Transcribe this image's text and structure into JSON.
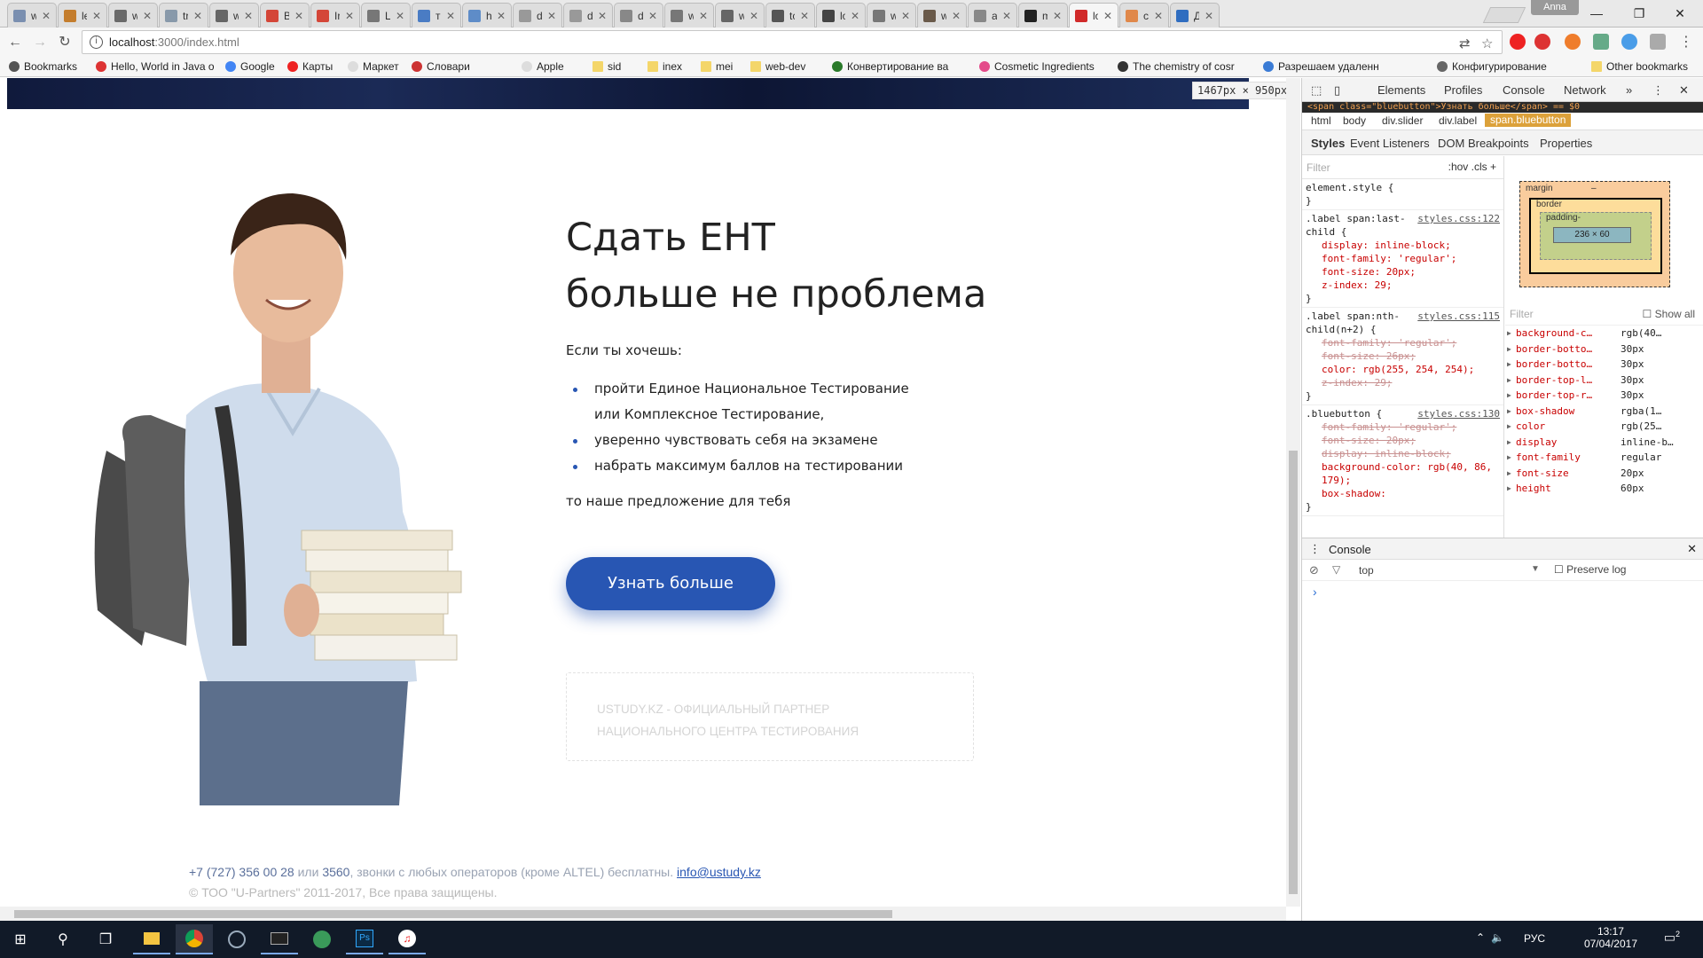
{
  "browser": {
    "tabs": [
      {
        "title": "w",
        "color": "#7a8fb0"
      },
      {
        "title": "le",
        "color": "#c47d2d"
      },
      {
        "title": "w",
        "color": "#6a6a6a"
      },
      {
        "title": "tr",
        "color": "#8899aa"
      },
      {
        "title": "w",
        "color": "#666666"
      },
      {
        "title": "B",
        "color": "#d44638"
      },
      {
        "title": "Ir",
        "color": "#d44638"
      },
      {
        "title": "Ц",
        "color": "#777777"
      },
      {
        "title": "тр",
        "color": "#4a7cc4"
      },
      {
        "title": "h",
        "color": "#5e8cc8"
      },
      {
        "title": "di",
        "color": "#999999"
      },
      {
        "title": "di",
        "color": "#999999"
      },
      {
        "title": "di",
        "color": "#888888"
      },
      {
        "title": "w",
        "color": "#777777"
      },
      {
        "title": "w",
        "color": "#666666"
      },
      {
        "title": "tc",
        "color": "#555555"
      },
      {
        "title": "lo",
        "color": "#444444"
      },
      {
        "title": "w",
        "color": "#777777"
      },
      {
        "title": "w",
        "color": "#6a5a4a"
      },
      {
        "title": "ai",
        "color": "#888888"
      },
      {
        "title": "m",
        "color": "#222222"
      },
      {
        "title": "lo",
        "color": "#d12a2a"
      },
      {
        "title": "c",
        "color": "#e0884a"
      },
      {
        "title": "Д",
        "color": "#2f6dc0"
      }
    ],
    "profile_name": "Anna",
    "url_host": "localhost",
    "url_rest": ":3000/index.html",
    "bookmarks": [
      "Bookmarks",
      "Hello, World in Java o",
      "Google",
      "Карты",
      "Маркет",
      "Словари",
      "Apple",
      "sid",
      "inex",
      "mei",
      "web-dev",
      "Конвертирование ва",
      "Cosmetic Ingredients",
      "The chemistry of cosr",
      "Разрешаем удаленн",
      "Конфигурирование"
    ],
    "other_bookmarks": "Other bookmarks",
    "viewport_size": "1467px × 950px"
  },
  "page": {
    "headline_line1": "Сдать ЕНТ",
    "headline_line2": "больше не проблема",
    "intro": "Если ты хочешь:",
    "bullets": [
      "пройти Единое Национальное Тестирование",
      "или Комплексное Тестирование,",
      "уверенно чувствовать себя на экзамене",
      "набрать максимум баллов на тестировании"
    ],
    "outro": "то наше предложение для тебя",
    "cta_label": "Узнать больше",
    "partner_line1": "USTUDY.KZ - ОФИЦИАЛЬНЫЙ ПАРТНЕР",
    "partner_line2": "НАЦИОНАЛЬНОГО ЦЕНТРА ТЕСТИРОВАНИЯ",
    "contact_phone": "+7 (727) 356 00 28",
    "contact_or": "или",
    "contact_short": "3560",
    "contact_note": ", звонки с любых операторов (кроме ALTEL) бесплатны.",
    "contact_email": "info@ustudy.kz",
    "copyright": "© ТОО \"U-Partners\" 2011-2017, Все права защищены.",
    "accent_color": "#2856b3"
  },
  "devtools": {
    "tabs": [
      "Elements",
      "Profiles",
      "Console",
      "Network"
    ],
    "selected_node": "<span class=\"bluebutton\">Узнать больше</span> == $0",
    "breadcrumbs": [
      "html",
      "body",
      "div.slider",
      "div.label",
      "span.bluebutton"
    ],
    "subtabs": [
      "Styles",
      "Event Listeners",
      "DOM Breakpoints",
      "Properties"
    ],
    "filter_placeholder": "Filter",
    "filter_tools": ":hov  .cls",
    "rules": [
      {
        "selector": "element.style {",
        "source": "",
        "props": []
      },
      {
        "selector": ".label span:last-child {",
        "source": "styles.css:122",
        "props": [
          {
            "text": "display: inline-block;",
            "strike": false
          },
          {
            "text": "font-family: 'regular';",
            "strike": false
          },
          {
            "text": "font-size: 20px;",
            "strike": false
          },
          {
            "text": "z-index: 29;",
            "strike": false
          }
        ]
      },
      {
        "selector": ".label span:nth-child(n+2) {",
        "source": "styles.css:115",
        "props": [
          {
            "text": "font-family: 'regular';",
            "strike": true
          },
          {
            "text": "font-size: 26px;",
            "strike": true
          },
          {
            "text": "color: rgb(255, 254, 254);",
            "strike": false
          },
          {
            "text": "z-index: 29;",
            "strike": true
          }
        ]
      },
      {
        "selector": ".bluebutton {",
        "source": "styles.css:130",
        "props": [
          {
            "text": "font-family: 'regular';",
            "strike": true
          },
          {
            "text": "font-size: 20px;",
            "strike": true
          },
          {
            "text": "display: inline-block;",
            "strike": true
          },
          {
            "text": "background-color: rgb(40, 86, 179);",
            "strike": false
          },
          {
            "text": "box-shadow:",
            "strike": false
          }
        ]
      }
    ],
    "box_model": {
      "margin": "margin",
      "border": "border",
      "padding": "padding-",
      "content": "236 × 60",
      "dash": "–"
    },
    "computed_filter": "Filter",
    "show_all": "Show all",
    "computed": [
      {
        "name": "background-c…",
        "value": "rgb(40…"
      },
      {
        "name": "border-botto…",
        "value": "30px"
      },
      {
        "name": "border-botto…",
        "value": "30px"
      },
      {
        "name": "border-top-l…",
        "value": "30px"
      },
      {
        "name": "border-top-r…",
        "value": "30px"
      },
      {
        "name": "box-shadow",
        "value": "rgba(1…"
      },
      {
        "name": "color",
        "value": "rgb(25…"
      },
      {
        "name": "display",
        "value": "inline-b…"
      },
      {
        "name": "font-family",
        "value": "regular"
      },
      {
        "name": "font-size",
        "value": "20px"
      },
      {
        "name": "height",
        "value": "60px"
      }
    ],
    "console_title": "Console",
    "console_context": "top",
    "preserve_log": "Preserve log",
    "console_prompt": "›"
  },
  "taskbar": {
    "lang": "РУС",
    "time": "13:17",
    "date": "07/04/2017",
    "notifications": "2"
  }
}
